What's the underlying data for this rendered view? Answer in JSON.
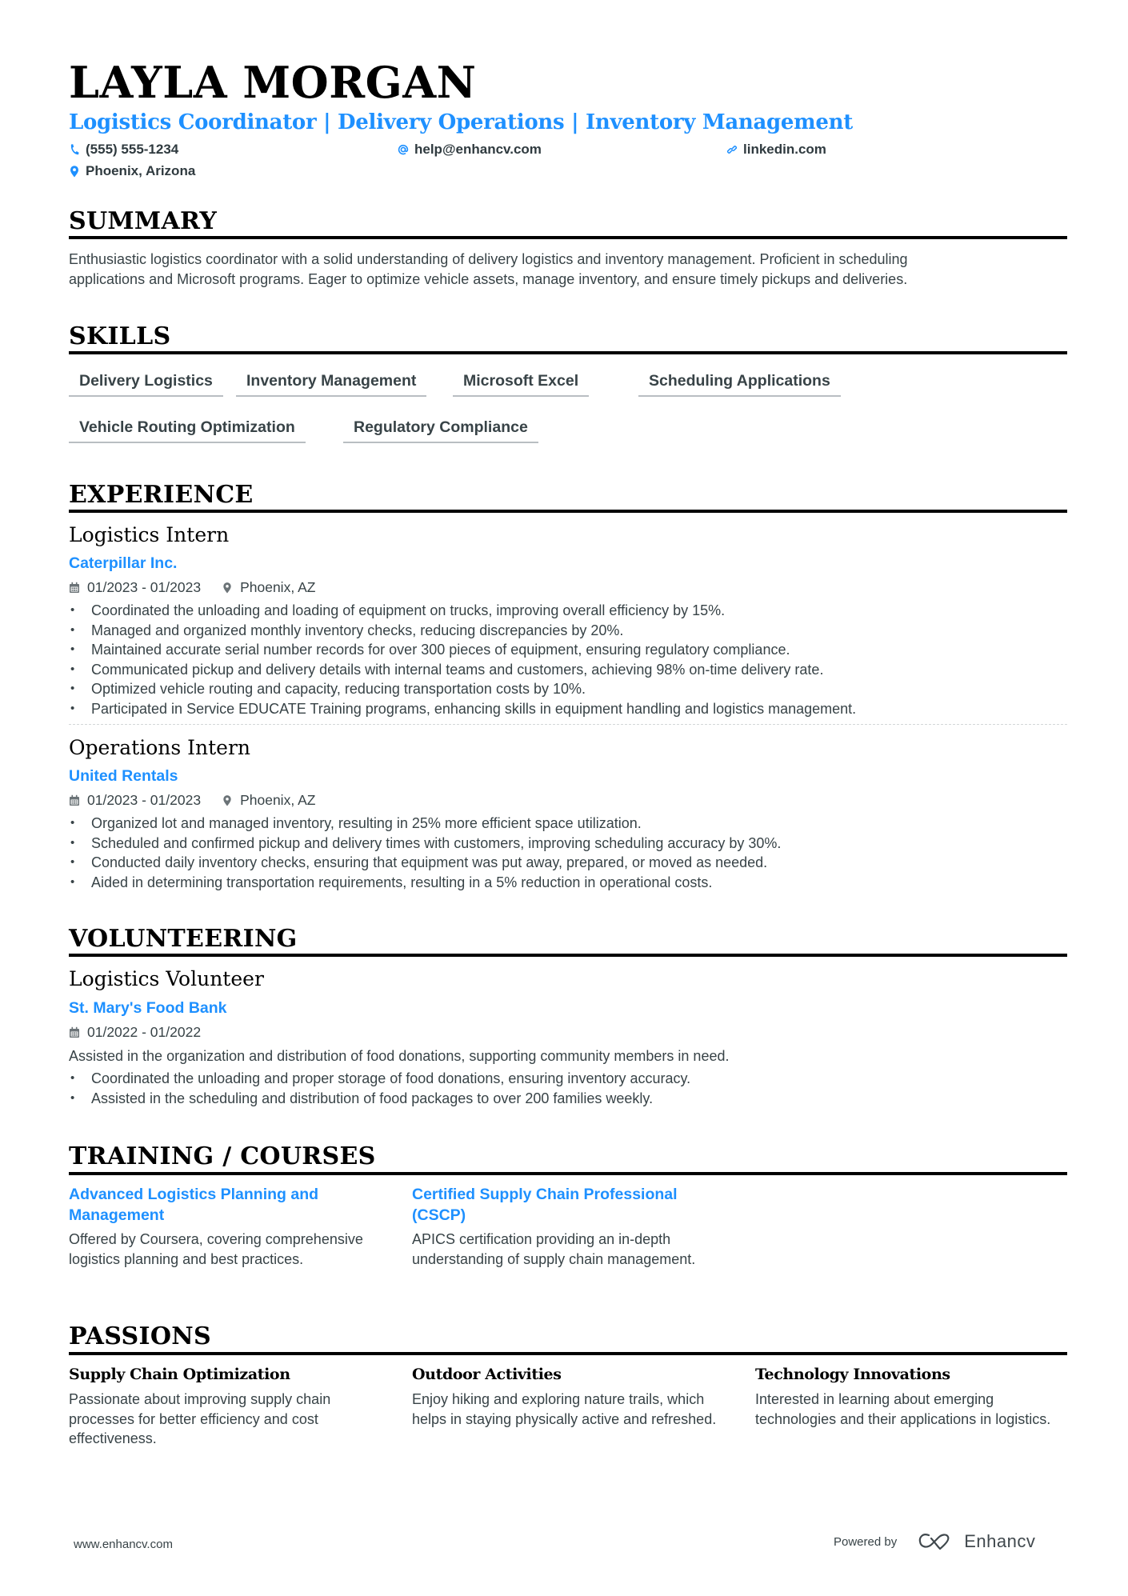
{
  "header": {
    "name": "LAYLA MORGAN",
    "headline": "Logistics Coordinator | Delivery Operations | Inventory Management",
    "contacts": {
      "phone": "(555) 555-1234",
      "email": "help@enhancv.com",
      "link": "linkedin.com",
      "location": "Phoenix, Arizona"
    },
    "accent_color": "#1e90ff"
  },
  "summary": {
    "title": "SUMMARY",
    "lines": [
      "Enthusiastic logistics coordinator with a solid understanding of delivery logistics and inventory management. Proficient in scheduling",
      "applications and Microsoft programs. Eager to optimize vehicle assets, manage inventory, and ensure timely pickups and deliveries."
    ]
  },
  "skills": {
    "title": "SKILLS",
    "items": [
      "Delivery Logistics",
      "Inventory Management",
      "Microsoft Excel",
      "Scheduling Applications",
      "Vehicle Routing Optimization",
      "Regulatory Compliance"
    ]
  },
  "experience": {
    "title": "EXPERIENCE",
    "items": [
      {
        "role": "Logistics Intern",
        "company": "Caterpillar Inc.",
        "dates": "01/2023 - 01/2023",
        "location": "Phoenix, AZ",
        "bullets": [
          "Coordinated the unloading and loading of equipment on trucks, improving overall efficiency by 15%.",
          "Managed and organized monthly inventory checks, reducing discrepancies by 20%.",
          "Maintained accurate serial number records for over 300 pieces of equipment, ensuring regulatory compliance.",
          "Communicated pickup and delivery details with internal teams and customers, achieving 98% on-time delivery rate.",
          "Optimized vehicle routing and capacity, reducing transportation costs by 10%.",
          "Participated in Service EDUCATE Training programs, enhancing skills in equipment handling and logistics management."
        ]
      },
      {
        "role": "Operations Intern",
        "company": "United Rentals",
        "dates": "01/2023 - 01/2023",
        "location": "Phoenix, AZ",
        "bullets": [
          "Organized lot and managed inventory, resulting in 25% more efficient space utilization.",
          "Scheduled and confirmed pickup and delivery times with customers, improving scheduling accuracy by 30%.",
          "Conducted daily inventory checks, ensuring that equipment was put away, prepared, or moved as needed.",
          "Aided in determining transportation requirements, resulting in a 5% reduction in operational costs."
        ]
      }
    ]
  },
  "volunteering": {
    "title": "VOLUNTEERING",
    "items": [
      {
        "role": "Logistics Volunteer",
        "company": "St. Mary's Food Bank",
        "dates": "01/2022 - 01/2022",
        "description": "Assisted in the organization and distribution of food donations, supporting community members in need.",
        "bullets": [
          "Coordinated the unloading and proper storage of food donations, ensuring inventory accuracy.",
          "Assisted in the scheduling and distribution of food packages to over 200 families weekly."
        ]
      }
    ]
  },
  "training": {
    "title": "TRAINING / COURSES",
    "items": [
      {
        "title": "Advanced Logistics Planning and Management",
        "description": "Offered by Coursera, covering comprehensive logistics planning and best practices."
      },
      {
        "title": "Certified Supply Chain Professional (CSCP)",
        "description": "APICS certification providing an in-depth understanding of supply chain management."
      }
    ]
  },
  "passions": {
    "title": "PASSIONS",
    "items": [
      {
        "title": "Supply Chain Optimization",
        "description": "Passionate about improving supply chain processes for better efficiency and cost effectiveness."
      },
      {
        "title": "Outdoor Activities",
        "description": "Enjoy hiking and exploring nature trails, which helps in staying physically active and refreshed."
      },
      {
        "title": "Technology Innovations",
        "description": "Interested in learning about emerging technologies and their applications in logistics."
      }
    ]
  },
  "footer": {
    "website": "www.enhancv.com",
    "powered_by": "Powered by",
    "brand": "Enhancv"
  }
}
